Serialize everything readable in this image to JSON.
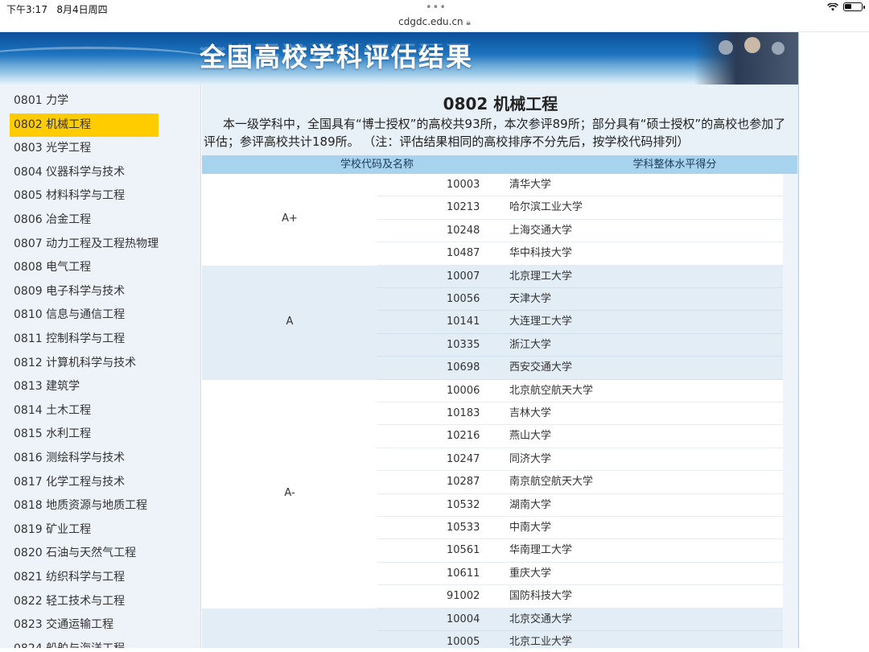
{
  "status": {
    "time": "下午3:17",
    "date": "8月4日周四",
    "url": "cdgdc.edu.cn",
    "dots": "•••"
  },
  "banner": {
    "title": "全国高校学科评估结果"
  },
  "sidebar": {
    "items": [
      {
        "label": "0801 力学",
        "active": false
      },
      {
        "label": "0802 机械工程",
        "active": true
      },
      {
        "label": "0803 光学工程",
        "active": false
      },
      {
        "label": "0804 仪器科学与技术",
        "active": false
      },
      {
        "label": "0805 材料科学与工程",
        "active": false
      },
      {
        "label": "0806 冶金工程",
        "active": false
      },
      {
        "label": "0807 动力工程及工程热物理",
        "active": false
      },
      {
        "label": "0808 电气工程",
        "active": false
      },
      {
        "label": "0809 电子科学与技术",
        "active": false
      },
      {
        "label": "0810 信息与通信工程",
        "active": false
      },
      {
        "label": "0811 控制科学与工程",
        "active": false
      },
      {
        "label": "0812 计算机科学与技术",
        "active": false
      },
      {
        "label": "0813 建筑学",
        "active": false
      },
      {
        "label": "0814 土木工程",
        "active": false
      },
      {
        "label": "0815 水利工程",
        "active": false
      },
      {
        "label": "0816 测绘科学与技术",
        "active": false
      },
      {
        "label": "0817 化学工程与技术",
        "active": false
      },
      {
        "label": "0818 地质资源与地质工程",
        "active": false
      },
      {
        "label": "0819 矿业工程",
        "active": false
      },
      {
        "label": "0820 石油与天然气工程",
        "active": false
      },
      {
        "label": "0821 纺织科学与工程",
        "active": false
      },
      {
        "label": "0822 轻工技术与工程",
        "active": false
      },
      {
        "label": "0823 交通运输工程",
        "active": false
      },
      {
        "label": "0824 船舶与海洋工程",
        "active": false
      }
    ]
  },
  "main": {
    "heading": "0802 机械工程",
    "intro": "本一级学科中，全国具有“博士授权”的高校共93所，本次参评89所；部分具有“硕士授权”的高校也参加了评估；参评高校共计189所。  （注：评估结果相同的高校排序不分先后，按学校代码排列）",
    "columns": [
      "学校代码及名称",
      "学科整体水平得分"
    ],
    "groups": [
      {
        "grade": "A+",
        "shade": "white",
        "rows": [
          {
            "code": "10003",
            "name": "清华大学"
          },
          {
            "code": "10213",
            "name": "哈尔滨工业大学"
          },
          {
            "code": "10248",
            "name": "上海交通大学"
          },
          {
            "code": "10487",
            "name": "华中科技大学"
          }
        ]
      },
      {
        "grade": "A",
        "shade": "blue",
        "rows": [
          {
            "code": "10007",
            "name": "北京理工大学"
          },
          {
            "code": "10056",
            "name": "天津大学"
          },
          {
            "code": "10141",
            "name": "大连理工大学"
          },
          {
            "code": "10335",
            "name": "浙江大学"
          },
          {
            "code": "10698",
            "name": "西安交通大学"
          }
        ]
      },
      {
        "grade": "A-",
        "shade": "white",
        "rows": [
          {
            "code": "10006",
            "name": "北京航空航天大学"
          },
          {
            "code": "10183",
            "name": "吉林大学"
          },
          {
            "code": "10216",
            "name": "燕山大学"
          },
          {
            "code": "10247",
            "name": "同济大学"
          },
          {
            "code": "10287",
            "name": "南京航空航天大学"
          },
          {
            "code": "10532",
            "name": "湖南大学"
          },
          {
            "code": "10533",
            "name": "中南大学"
          },
          {
            "code": "10561",
            "name": "华南理工大学"
          },
          {
            "code": "10611",
            "name": "重庆大学"
          },
          {
            "code": "91002",
            "name": "国防科技大学"
          }
        ]
      },
      {
        "grade": "",
        "shade": "blue",
        "rows": [
          {
            "code": "10004",
            "name": "北京交通大学"
          },
          {
            "code": "10005",
            "name": "北京工业大学"
          }
        ]
      }
    ]
  }
}
